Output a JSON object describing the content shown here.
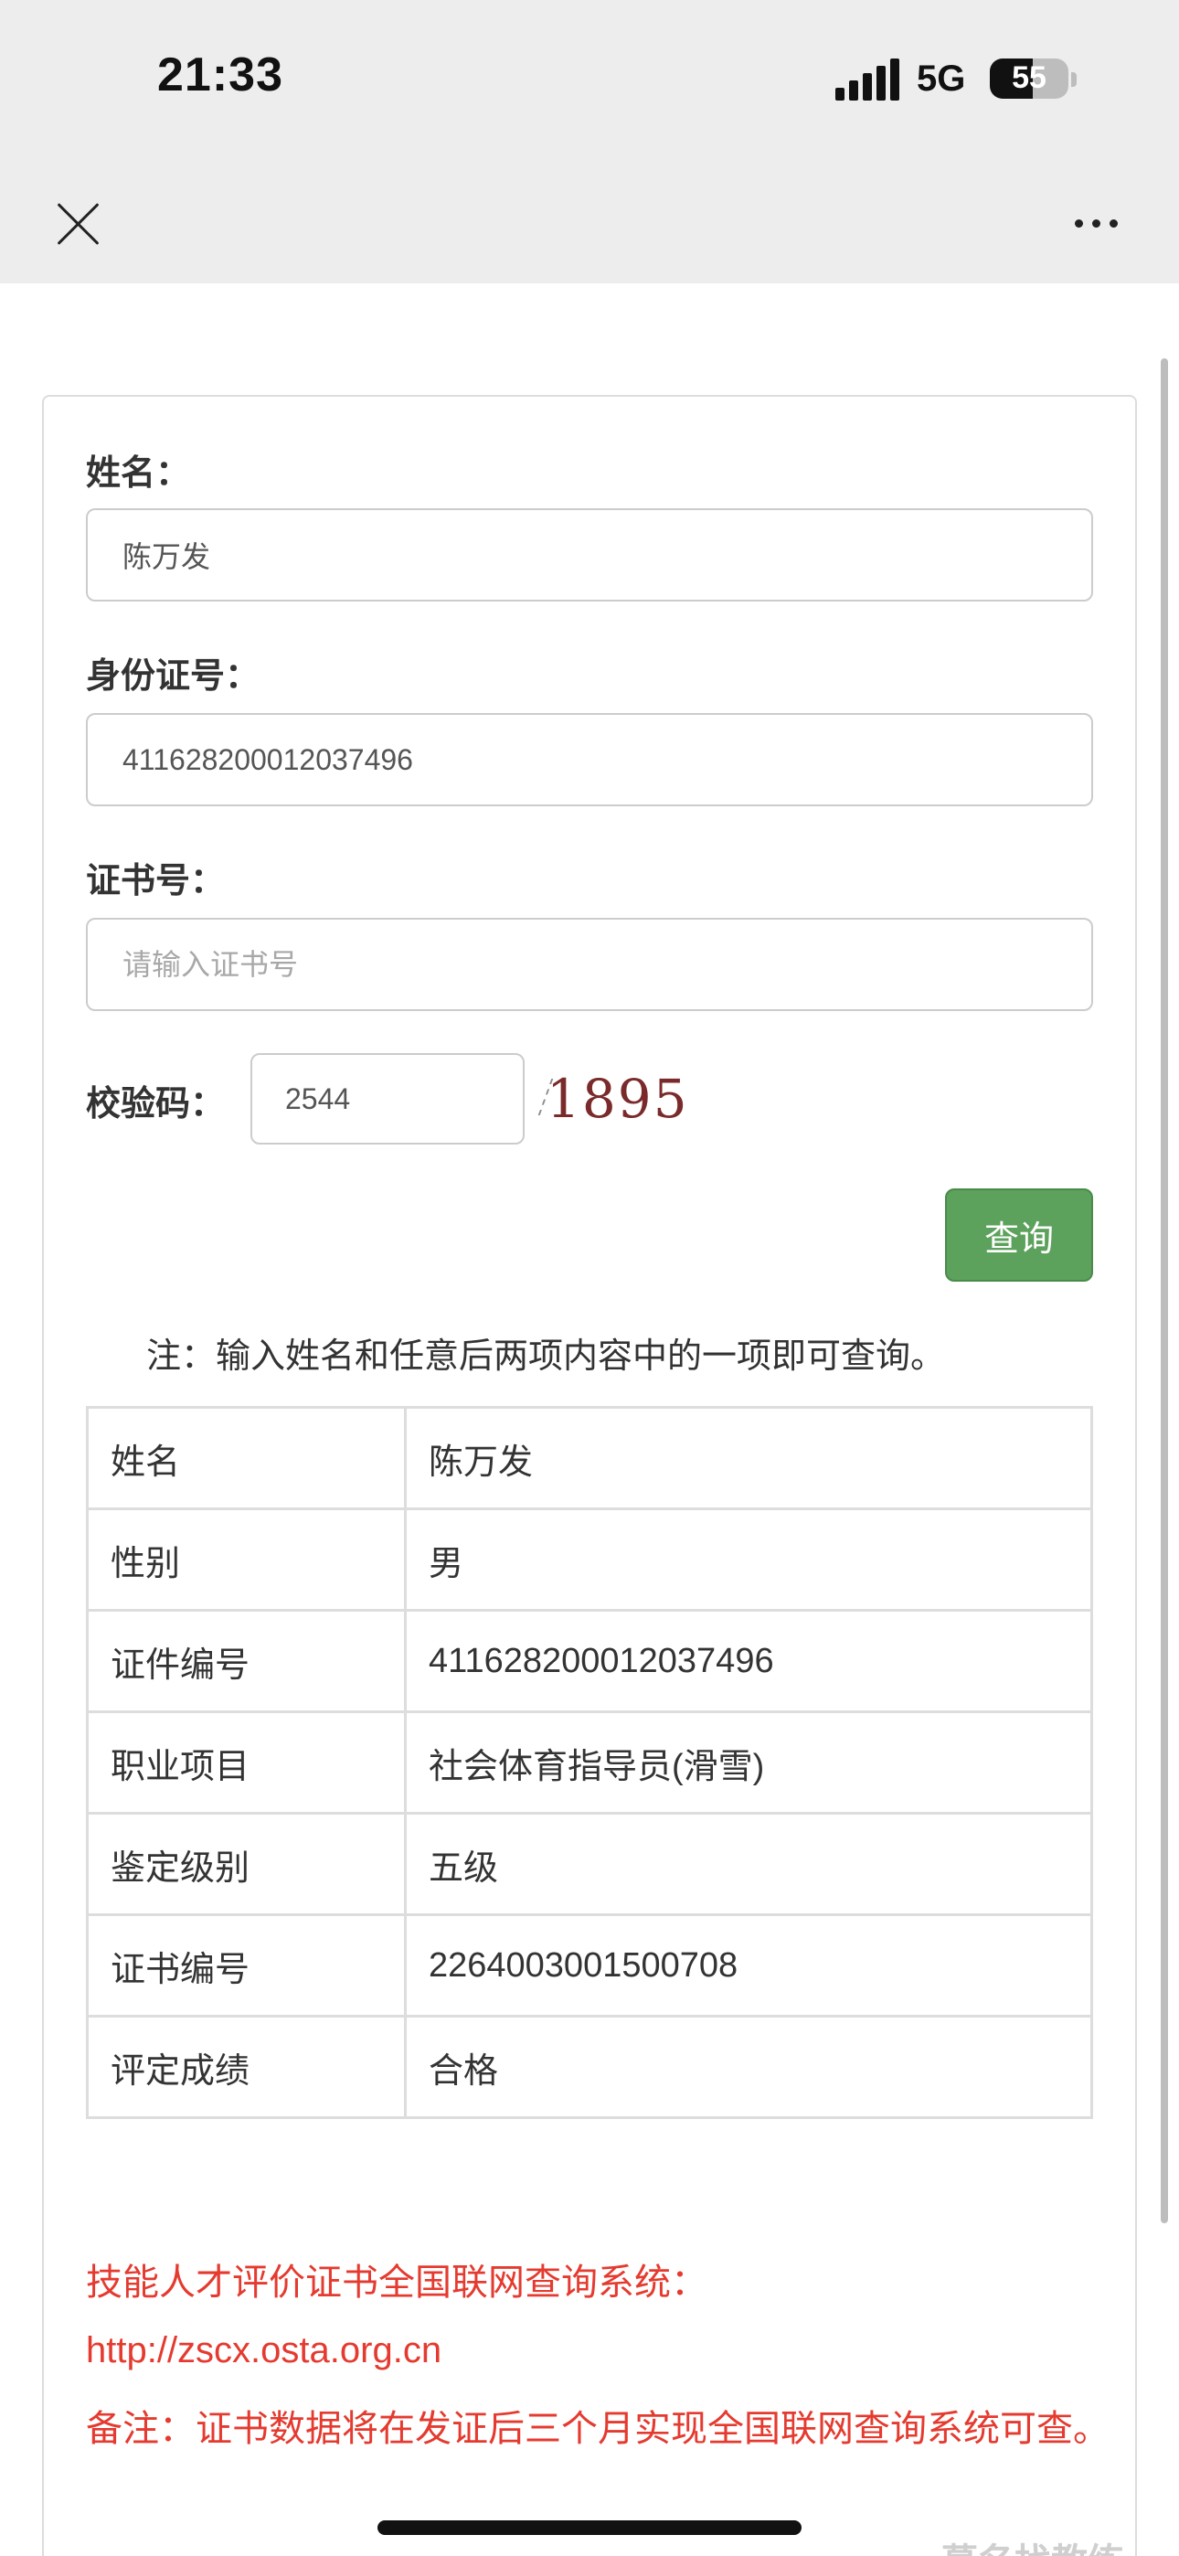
{
  "status_bar": {
    "time": "21:33",
    "network": "5G",
    "battery": "55",
    "battery_level_percent": 55
  },
  "nav": {
    "close_icon": "close-icon",
    "more_icon": "more-dots-icon"
  },
  "form": {
    "name_label": "姓名：",
    "name_value": "陈万发",
    "id_label": "身份证号：",
    "id_value": "411628200012037496",
    "cert_label": "证书号：",
    "cert_placeholder": "请输入证书号",
    "captcha_label": "校验码：",
    "captcha_value": "2544",
    "captcha_image_text": "1895",
    "submit_label": "查询",
    "note": "注：输入姓名和任意后两项内容中的一项即可查询。"
  },
  "result": {
    "rows": [
      {
        "key": "姓名",
        "value": "陈万发"
      },
      {
        "key": "性别",
        "value": "男"
      },
      {
        "key": "证件编号",
        "value": "411628200012037496"
      },
      {
        "key": "职业项目",
        "value": "社会体育指导员(滑雪)"
      },
      {
        "key": "鉴定级别",
        "value": "五级"
      },
      {
        "key": "证书编号",
        "value": "2264003001500708"
      },
      {
        "key": "评定成绩",
        "value": "合格"
      }
    ]
  },
  "footer": {
    "system_title": "技能人才评价证书全国联网查询系统：",
    "system_url": "http://zscx.osta.org.cn",
    "remark": "备注：证书数据将在发证后三个月实现全国联网查询系统可查。"
  },
  "watermark": "慕名找教练",
  "colors": {
    "submit_green": "#5ca15c",
    "notice_red": "#e53a2f",
    "topbar_gray": "#ededed"
  }
}
